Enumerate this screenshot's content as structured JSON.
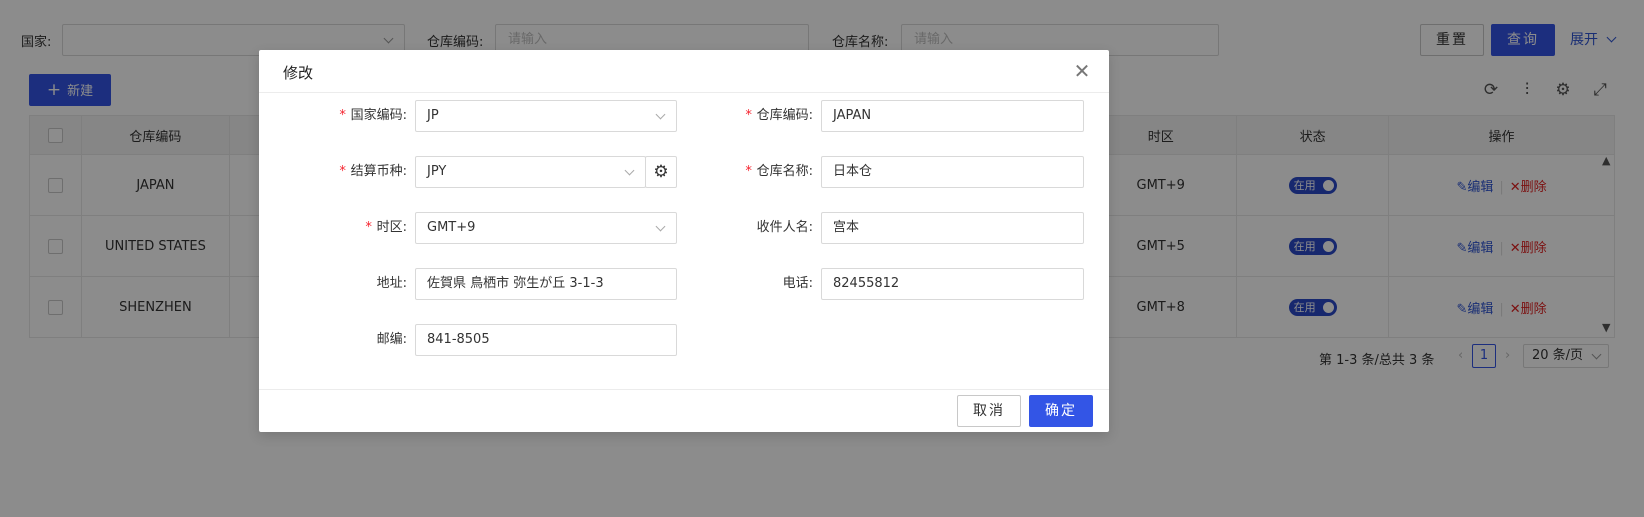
{
  "filters": {
    "country_label": "国家:",
    "country_value": "",
    "warehouse_code_label": "仓库编码:",
    "warehouse_code_placeholder": "请输入",
    "warehouse_name_label": "仓库名称:",
    "warehouse_name_placeholder": "请输入",
    "reset_label": "重置",
    "query_label": "查询",
    "expand_label": "展开"
  },
  "toolbar": {
    "new_label": "新建",
    "icons": [
      "refresh-icon",
      "column-height-icon",
      "settings-icon",
      "fullscreen-icon"
    ]
  },
  "table": {
    "headers": {
      "code": "仓库编码",
      "timezone": "时区",
      "status": "状态",
      "actions": "操作"
    },
    "rows": [
      {
        "code": "JAPAN",
        "timezone": "GMT+9",
        "status": "在用",
        "edit": "编辑",
        "delete": "删除"
      },
      {
        "code": "UNITED STATES",
        "timezone": "GMT+5",
        "status": "在用",
        "edit": "编辑",
        "delete": "删除"
      },
      {
        "code": "SHENZHEN",
        "timezone": "GMT+8",
        "status": "在用",
        "edit": "编辑",
        "delete": "删除"
      }
    ]
  },
  "pagination": {
    "summary": "第 1-3 条/总共 3 条",
    "current_page": "1",
    "page_size": "20 条/页"
  },
  "modal": {
    "title": "修改",
    "fields": {
      "country_code": {
        "label": "国家编码:",
        "value": "JP"
      },
      "warehouse_code": {
        "label": "仓库编码:",
        "value": "JAPAN"
      },
      "currency": {
        "label": "结算币种:",
        "value": "JPY"
      },
      "warehouse_name": {
        "label": "仓库名称:",
        "value": "日本仓"
      },
      "timezone": {
        "label": "时区:",
        "value": "GMT+9"
      },
      "recipient": {
        "label": "收件人名:",
        "value": "宫本"
      },
      "address": {
        "label": "地址:",
        "value": "佐賀県 鳥栖市 弥生が丘 3-1-3"
      },
      "phone": {
        "label": "电话:",
        "value": "82455812"
      },
      "postcode": {
        "label": "邮编:",
        "value": "841-8505"
      }
    },
    "cancel_label": "取消",
    "confirm_label": "确定"
  },
  "colors": {
    "primary": "#3355e6",
    "danger": "#e02020",
    "required": "#f5222d"
  }
}
